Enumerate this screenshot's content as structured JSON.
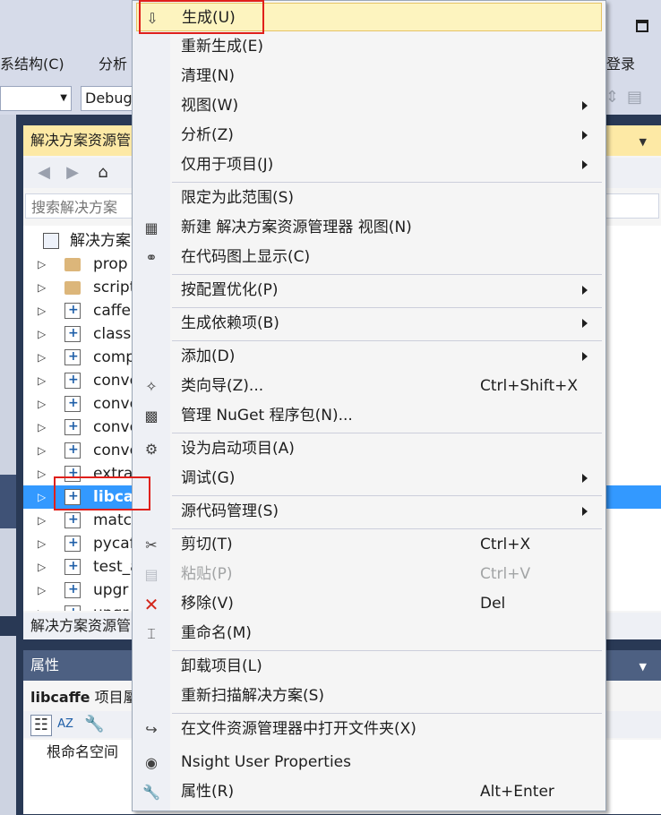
{
  "menubar": {
    "partial_items": [
      "系结构(C)",
      "分析",
      "登录"
    ]
  },
  "toolbar": {
    "config_combo": "Debug"
  },
  "solution_explorer": {
    "title": "解决方案资源管",
    "search_placeholder": "搜索解决方案",
    "root": "解决方案",
    "items": [
      {
        "label": "prop",
        "type": "folder"
      },
      {
        "label": "script",
        "type": "folder"
      },
      {
        "label": "caffe",
        "type": "project"
      },
      {
        "label": "classi",
        "type": "project"
      },
      {
        "label": "comp",
        "type": "project"
      },
      {
        "label": "conve",
        "type": "project"
      },
      {
        "label": "conve",
        "type": "project"
      },
      {
        "label": "conve",
        "type": "project"
      },
      {
        "label": "conve",
        "type": "project"
      },
      {
        "label": "extra",
        "type": "project"
      },
      {
        "label": "libcaf",
        "type": "project",
        "selected": true
      },
      {
        "label": "matc",
        "type": "project"
      },
      {
        "label": "pycaf",
        "type": "project"
      },
      {
        "label": "test_a",
        "type": "project"
      },
      {
        "label": "upgr",
        "type": "project"
      },
      {
        "label": "upgr",
        "type": "project"
      }
    ],
    "bottom_tab": "解决方案资源管"
  },
  "properties": {
    "title": "属性",
    "object_name": "libcaffe",
    "object_type": "项目屬",
    "row_label": "根命名空间"
  },
  "context_menu": {
    "items": [
      {
        "label": "生成(U)",
        "icon": "build-icon",
        "highlighted": true
      },
      {
        "label": "重新生成(E)"
      },
      {
        "label": "清理(N)"
      },
      {
        "label": "视图(W)",
        "submenu": true
      },
      {
        "label": "分析(Z)",
        "submenu": true
      },
      {
        "label": "仅用于项目(J)",
        "submenu": true
      },
      {
        "separator": true
      },
      {
        "label": "限定为此范围(S)"
      },
      {
        "label": "新建 解决方案资源管理器 视图(N)",
        "icon": "new-view-icon"
      },
      {
        "label": "在代码图上显示(C)",
        "icon": "code-map-icon"
      },
      {
        "separator": true
      },
      {
        "label": "按配置优化(P)",
        "submenu": true
      },
      {
        "separator": true
      },
      {
        "label": "生成依赖项(B)",
        "submenu": true
      },
      {
        "separator": true
      },
      {
        "label": "添加(D)",
        "submenu": true
      },
      {
        "label": "类向导(Z)...",
        "icon": "class-wizard-icon",
        "shortcut": "Ctrl+Shift+X"
      },
      {
        "label": "管理 NuGet 程序包(N)...",
        "icon": "nuget-icon"
      },
      {
        "separator": true
      },
      {
        "label": "设为启动项目(A)",
        "icon": "gear-icon"
      },
      {
        "label": "调试(G)",
        "submenu": true
      },
      {
        "separator": true
      },
      {
        "label": "源代码管理(S)",
        "submenu": true
      },
      {
        "separator": true
      },
      {
        "label": "剪切(T)",
        "icon": "scissors-icon",
        "shortcut": "Ctrl+X"
      },
      {
        "label": "粘贴(P)",
        "icon": "paste-icon",
        "shortcut": "Ctrl+V",
        "disabled": true
      },
      {
        "label": "移除(V)",
        "icon": "remove-x-icon",
        "shortcut": "Del"
      },
      {
        "label": "重命名(M)",
        "icon": "rename-icon"
      },
      {
        "separator": true
      },
      {
        "label": "卸载项目(L)"
      },
      {
        "label": "重新扫描解决方案(S)"
      },
      {
        "separator": true
      },
      {
        "label": "在文件资源管理器中打开文件夹(X)",
        "icon": "open-folder-arrow-icon"
      },
      {
        "label": "Nsight User Properties",
        "icon": "nsight-icon"
      },
      {
        "label": "属性(R)",
        "icon": "wrench-icon",
        "shortcut": "Alt+Enter"
      }
    ]
  },
  "colors": {
    "accent_selection": "#3399ff",
    "menu_highlight": "#fdf4bf",
    "annotation_red": "#e0201b",
    "panel_header_active": "#fde9a5"
  }
}
